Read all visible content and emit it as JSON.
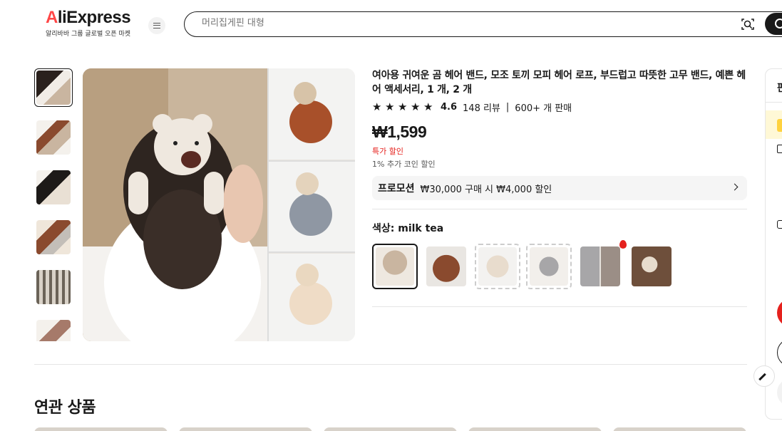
{
  "header": {
    "logo_text": "AliExpress",
    "logo_sub": "알리바바 그룹 글로벌 오픈 마켓",
    "search_placeholder": "머리집게핀 대형"
  },
  "product": {
    "title": "여아용 귀여운 곰 헤어 밴드, 모조 토끼 모피 헤어 로프, 부드럽고 따뜻한 고무 밴드, 예쁜 헤어 액세서리, 1 개, 2 개",
    "rating": "4.6",
    "reviews": "148 리뷰",
    "sold": "600+ 개 판매",
    "price": "₩1,599",
    "deal_label": "특가 할인",
    "coin_text": "1% 추가 코인 할인",
    "promo_tag": "프로모션",
    "promo_text": "₩30,000 구매 시 ₩4,000 할인",
    "color_label": "색상: milk tea"
  },
  "swatches": [
    {
      "name": "milk tea",
      "color": "#c9b5a0",
      "selected": true
    },
    {
      "name": "brown",
      "color": "#8a4a2e",
      "selected": false
    },
    {
      "name": "beige",
      "color": "#e8dccd",
      "selected": false
    },
    {
      "name": "gray",
      "color": "#a7a6a8",
      "selected": false
    },
    {
      "name": "gray-set",
      "color": "#9b8e86",
      "selected": false
    },
    {
      "name": "set",
      "color": "#8b6a52",
      "selected": false
    }
  ],
  "sidebar": {
    "title_fragment": "판"
  },
  "section": {
    "related_title": "연관 상품"
  },
  "colors": {
    "accent": "#e5211d",
    "text": "#191919"
  }
}
